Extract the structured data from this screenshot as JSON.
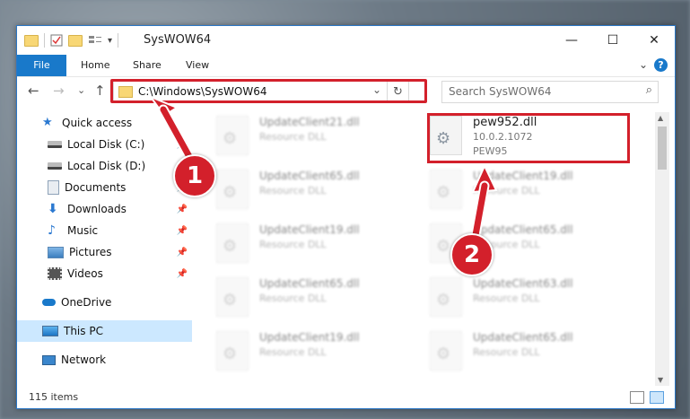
{
  "window": {
    "title": "SysWOW64",
    "minimize": "—",
    "maximize": "☐",
    "close": "✕"
  },
  "ribbon": {
    "tabs": [
      "File",
      "Home",
      "Share",
      "View"
    ],
    "help": "?"
  },
  "navbar": {
    "back": "←",
    "forward": "→",
    "recent": "⌄",
    "up": "↑",
    "path": "C:\\Windows\\SysWOW64",
    "dropdown": "⌄",
    "refresh": "↻",
    "search_placeholder": "Search SysWOW64",
    "search_icon": "⌕"
  },
  "sidebar": {
    "items": [
      {
        "label": "Quick access",
        "icon": "star-icon"
      },
      {
        "label": "Local Disk (C:)",
        "icon": "drive-icon"
      },
      {
        "label": "Local Disk (D:)",
        "icon": "drive-icon"
      },
      {
        "label": "Documents",
        "icon": "documents-icon"
      },
      {
        "label": "Downloads",
        "icon": "download-icon"
      },
      {
        "label": "Music",
        "icon": "music-icon"
      },
      {
        "label": "Pictures",
        "icon": "pictures-icon"
      },
      {
        "label": "Videos",
        "icon": "videos-icon"
      },
      {
        "label": "OneDrive",
        "icon": "cloud-icon"
      },
      {
        "label": "This PC",
        "icon": "computer-icon"
      },
      {
        "label": "Network",
        "icon": "network-icon"
      }
    ]
  },
  "files": {
    "left": [
      {
        "name": "UpdateClient21.dll",
        "desc": "Resource DLL"
      },
      {
        "name": "UpdateClient65.dll",
        "desc": "Resource DLL"
      },
      {
        "name": "UpdateClient19.dll",
        "desc": "Resource DLL"
      },
      {
        "name": "UpdateClient65.dll",
        "desc": "Resource DLL"
      },
      {
        "name": "UpdateClient19.dll",
        "desc": "Resource DLL"
      }
    ],
    "right": [
      {
        "name": "UpdateClient19.dll",
        "desc": "Resource DLL"
      },
      {
        "name": "UpdateClient65.dll",
        "desc": "Resource DLL"
      },
      {
        "name": "UpdateClient63.dll",
        "desc": "Resource DLL"
      },
      {
        "name": "UpdateClient65.dll",
        "desc": "Resource DLL"
      }
    ],
    "highlighted": {
      "name": "pew952.dll",
      "version": "10.0.2.1072",
      "company": "PEW95"
    }
  },
  "annotations": {
    "step1": "1",
    "step2": "2",
    "color": "#d3202b"
  },
  "status": {
    "items": "115 items"
  }
}
